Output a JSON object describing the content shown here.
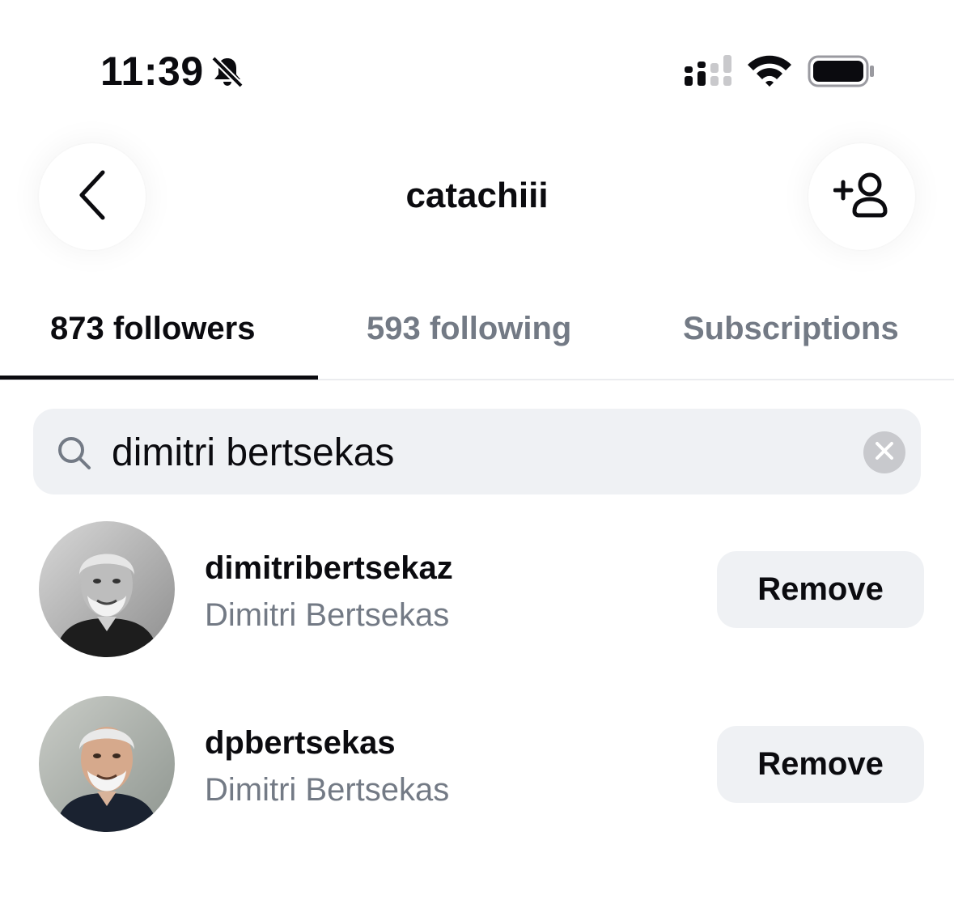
{
  "status_bar": {
    "time": "11:39",
    "icons": [
      "bell-slash-icon",
      "cellular-signal-icon",
      "wifi-icon",
      "battery-icon"
    ]
  },
  "header": {
    "title": "catachiii",
    "back_icon": "chevron-left-icon",
    "add_person_icon": "add-person-icon"
  },
  "tabs": [
    {
      "label": "873 followers",
      "active": true
    },
    {
      "label": "593 following",
      "active": false
    },
    {
      "label": "Subscriptions",
      "active": false
    }
  ],
  "search": {
    "value": "dimitri bertsekas",
    "icon": "search-icon",
    "clear_icon": "clear-icon"
  },
  "results": [
    {
      "username": "dimitribertsekaz",
      "full_name": "Dimitri Bertsekas",
      "action_label": "Remove"
    },
    {
      "username": "dpbertsekas",
      "full_name": "Dimitri Bertsekas",
      "action_label": "Remove"
    }
  ],
  "colors": {
    "accent_text": "#0b0b0f",
    "secondary_text": "#737a85",
    "input_background": "#eff1f4"
  }
}
